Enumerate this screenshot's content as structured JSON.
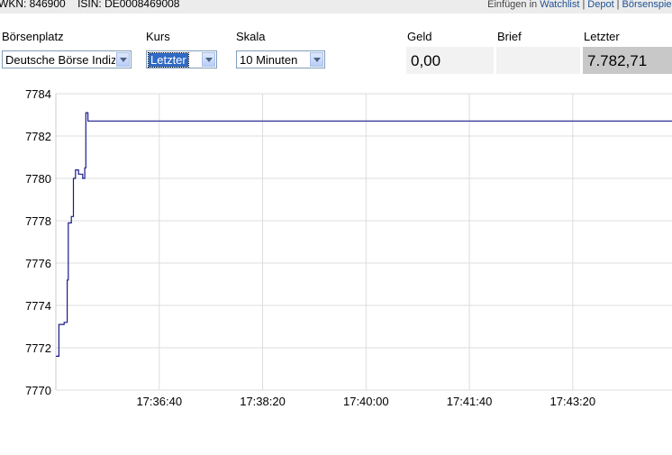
{
  "header": {
    "wkn": "WKN: 846900",
    "isin": "ISIN: DE0008469008",
    "insert_label": "Einfügen in",
    "links": [
      "Watchlist",
      "Depot",
      "Börsenspiel"
    ]
  },
  "controls": {
    "exchange": {
      "label": "Börsenplatz",
      "value": "Deutsche Börse Indizes"
    },
    "price": {
      "label": "Kurs",
      "value": "Letzter"
    },
    "scale": {
      "label": "Skala",
      "value": "10 Minuten"
    }
  },
  "quote": {
    "bid": {
      "label": "Geld",
      "value": "0,00"
    },
    "ask": {
      "label": "Brief",
      "value": ""
    },
    "last": {
      "label": "Letzter",
      "value": "7.782,71"
    }
  },
  "colors": {
    "line": "#1a1a8c",
    "grid": "#dddddd",
    "quote_bg": "#f2f2f2",
    "last_bg": "#c8c8c8",
    "topbar_bg": "#ececec",
    "link": "#1d4f91"
  },
  "chart_data": {
    "type": "line",
    "title": "",
    "xlabel": "",
    "ylabel": "",
    "x_tick_labels": [
      "17:36:40",
      "17:38:20",
      "17:40:00",
      "17:41:40",
      "17:43:20"
    ],
    "x_ticks_seconds": [
      100,
      200,
      300,
      400,
      500
    ],
    "x_range_seconds": [
      0,
      596
    ],
    "ylim": [
      7770,
      7784
    ],
    "y_ticks": [
      7770,
      7772,
      7774,
      7776,
      7778,
      7780,
      7782,
      7784
    ],
    "grid": true,
    "step": true,
    "series": [
      {
        "name": "",
        "points": [
          [
            0,
            7771.6
          ],
          [
            3,
            7771.6
          ],
          [
            3,
            7773.1
          ],
          [
            8,
            7773.1
          ],
          [
            8,
            7773.2
          ],
          [
            11,
            7773.2
          ],
          [
            11,
            7775.2
          ],
          [
            12,
            7775.2
          ],
          [
            12,
            7777.9
          ],
          [
            15,
            7777.9
          ],
          [
            15,
            7778.2
          ],
          [
            17,
            7778.2
          ],
          [
            17,
            7780.0
          ],
          [
            19,
            7780.0
          ],
          [
            19,
            7780.4
          ],
          [
            22,
            7780.4
          ],
          [
            22,
            7780.2
          ],
          [
            26,
            7780.2
          ],
          [
            26,
            7780.0
          ],
          [
            28,
            7780.0
          ],
          [
            28,
            7780.5
          ],
          [
            29,
            7780.5
          ],
          [
            29,
            7783.1
          ],
          [
            31,
            7783.1
          ],
          [
            31,
            7782.71
          ],
          [
            596,
            7782.71
          ]
        ]
      }
    ]
  }
}
